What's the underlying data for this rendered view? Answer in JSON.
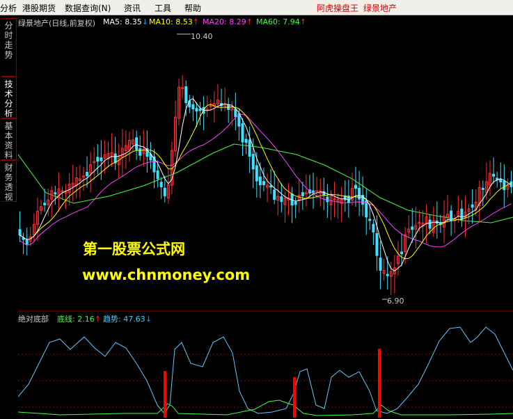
{
  "menu": {
    "items": [
      "分析",
      "港股期货",
      "数据查询(N)",
      "资讯",
      "工具",
      "帮助"
    ],
    "right_app": "阿虎操盘王",
    "right_stock": "绿景地产"
  },
  "sidebar": {
    "tabs": [
      "分时走势",
      "技术分析",
      "基本资料",
      "财务透视"
    ],
    "active": "技术分析"
  },
  "price_panel": {
    "title": "绿景地产(日线,前复权)",
    "ma": [
      {
        "label": "MA5: 8.35",
        "arrow": "↓",
        "color": "#ffffff",
        "arrow_color": "#19a0ff"
      },
      {
        "label": "MA10: 8.53",
        "arrow": "↑",
        "color": "#ffff00",
        "arrow_color": "#ff2020"
      },
      {
        "label": "MA20: 8.29",
        "arrow": "↑",
        "color": "#ff40ff",
        "arrow_color": "#ff2020"
      },
      {
        "label": "MA60: 7.94",
        "arrow": "↑",
        "color": "#40ff40",
        "arrow_color": "#ff2020"
      }
    ],
    "high_label": "10.40",
    "low_label": "6.90"
  },
  "indicator_panel": {
    "title": "绝对底部",
    "line1": {
      "label": "底线: 2.16",
      "arrow": "↑",
      "color": "#40ff40",
      "arrow_color": "#ff2020"
    },
    "line2": {
      "label": "趋势: 47.63",
      "arrow": "↓",
      "color": "#40d0ff",
      "arrow_color": "#19a0ff"
    }
  },
  "watermark": {
    "line1": "第一股票公式网",
    "line2": "www.chnmoney.com"
  },
  "chart_data": {
    "type": "line",
    "price_range": [
      6.9,
      10.4
    ],
    "candle_count": 140,
    "ma_series": [
      {
        "name": "MA5"
      },
      {
        "name": "MA10"
      },
      {
        "name": "MA20"
      },
      {
        "name": "MA60"
      }
    ],
    "indicator_series": [
      {
        "name": "底线"
      },
      {
        "name": "趋势"
      }
    ],
    "signal_bars": 3
  },
  "colors": {
    "up": "#ff3030",
    "down": "#40e0ff",
    "grid": "#8b0000",
    "ma5": "#ffffff",
    "ma10": "#ffff00",
    "ma20": "#ff40ff",
    "ma60": "#40ff40",
    "trend": "#60c8ff",
    "base": "#40ff40",
    "signal": "#ff0000"
  }
}
